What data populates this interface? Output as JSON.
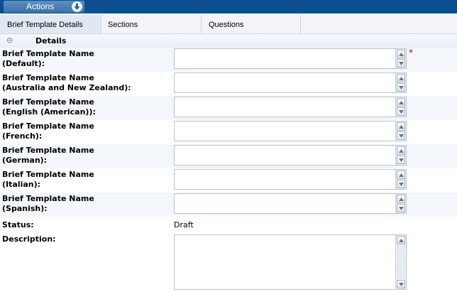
{
  "toolbar": {
    "actions_label": "Actions"
  },
  "tabs": [
    {
      "label": "Brief Template Details"
    },
    {
      "label": "Sections"
    },
    {
      "label": "Questions"
    }
  ],
  "section": {
    "title": "Details"
  },
  "fields": [
    {
      "label_line1": "Brief Template Name",
      "label_line2": "(Default):",
      "value": "",
      "required_mark": "*"
    },
    {
      "label_line1": "Brief Template Name",
      "label_line2": "(Australia and New Zealand):",
      "value": ""
    },
    {
      "label_line1": "Brief Template Name",
      "label_line2": "(English (American)):",
      "value": ""
    },
    {
      "label_line1": "Brief Template Name",
      "label_line2": "(French):",
      "value": ""
    },
    {
      "label_line1": "Brief Template Name",
      "label_line2": "(German):",
      "value": ""
    },
    {
      "label_line1": "Brief Template Name",
      "label_line2": "(Italian):",
      "value": ""
    },
    {
      "label_line1": "Brief Template Name",
      "label_line2": "(Spanish):",
      "value": ""
    }
  ],
  "status": {
    "label": "Status:",
    "value": "Draft"
  },
  "description": {
    "label": "Description:",
    "value": ""
  },
  "icons": {
    "actions_arrow": "arrow-down-icon",
    "collapse": "collapse-icon",
    "scroll_up": "scroll-up-icon",
    "scroll_down": "scroll-down-icon"
  },
  "colors": {
    "header_bar": "#0a4f8f",
    "required": "#c00000"
  }
}
